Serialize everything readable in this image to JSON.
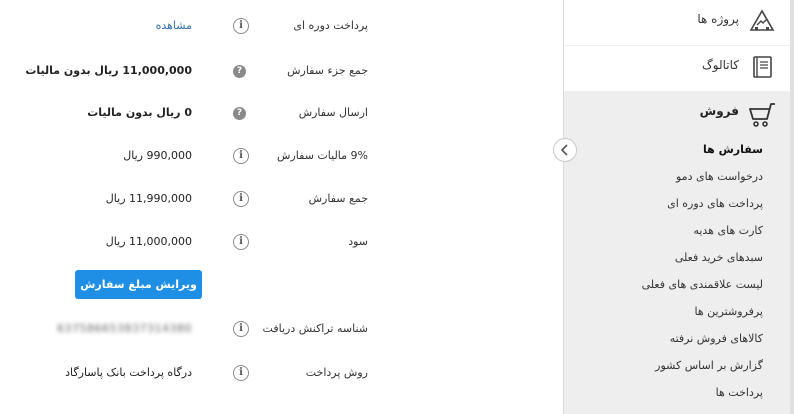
{
  "order_details": {
    "rows": [
      {
        "label": "پرداخت دوره ای",
        "value": "مشاهده"
      },
      {
        "label": "جمع جزء سفارش",
        "value": "11,000,000 ریال بدون مالیات"
      },
      {
        "label": "ارسال سفارش",
        "value": "0 ریال بدون مالیات"
      },
      {
        "label": "9% مالیات سفارش",
        "value": "990,000 ریال"
      },
      {
        "label": "جمع سفارش",
        "value": "11,990,000 ریال"
      },
      {
        "label": "سود",
        "value": "11,000,000 ریال"
      },
      {
        "label": "شناسه تراکنش دریافت",
        "value": "637586653837314380"
      },
      {
        "label": "روش پرداخت",
        "value": "درگاه پرداخت بانک پاسارگاد"
      }
    ],
    "edit_button_label": "ویرایش مبلغ سفارش",
    "info_icon_glyph": "i",
    "help_icon_glyph": "?"
  },
  "sidebar": {
    "projects_label": "پروژه ها",
    "catalog_label": "کاتالوگ",
    "sales_label": "فروش",
    "sales_items": [
      "سفارش ها",
      "درخواست های دمو",
      "پرداخت های دوره ای",
      "کارت های هدیه",
      "سبدهای خرید فعلی",
      "لیست علاقمندی های فعلی",
      "پرفروشترین ها",
      "کالاهای فروش نرفته",
      "گزارش بر اساس کشور",
      "پرداخت ها"
    ]
  },
  "colors": {
    "accent": "#1f8ee5",
    "link": "#2f6fb3",
    "sidebar_bg": "#eeeeee"
  },
  "icons": {
    "projects": "projects-icon",
    "catalog": "book-icon",
    "sales": "cart-icon",
    "toggle": "chevron-left-icon",
    "info": "info-icon",
    "help": "help-icon"
  }
}
